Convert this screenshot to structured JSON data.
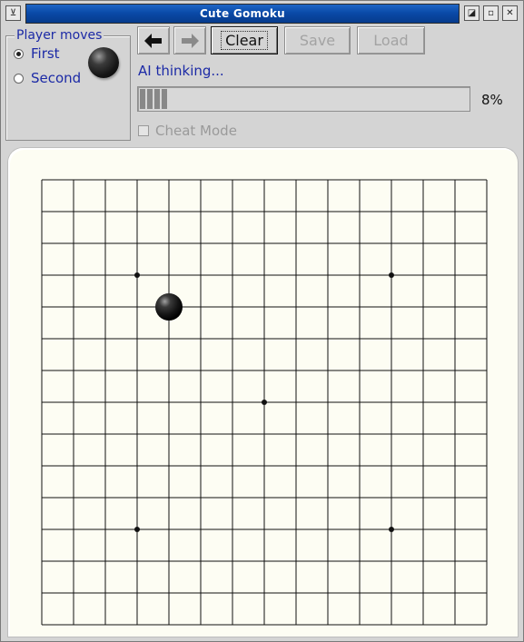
{
  "window": {
    "title": "Cute Gomoku",
    "menu_icon": "window-menu-icon",
    "buttons": [
      "maximize-icon",
      "minimize-icon",
      "close-icon"
    ]
  },
  "player_moves": {
    "title": "Player moves",
    "options": [
      {
        "label": "First",
        "selected": true
      },
      {
        "label": "Second",
        "selected": false
      }
    ],
    "stone_color": "black"
  },
  "toolbar": {
    "back_icon": "arrow-left-icon",
    "forward_icon": "arrow-right-icon",
    "clear_label": "Clear",
    "save_label": "Save",
    "load_label": "Load"
  },
  "status": {
    "thinking_text": "AI thinking...",
    "progress_percent": 8,
    "progress_label": "8%"
  },
  "cheat_mode": {
    "label": "Cheat Mode",
    "checked": false,
    "enabled": false
  },
  "board": {
    "size": 15,
    "star_points": [
      [
        3,
        3
      ],
      [
        11,
        3
      ],
      [
        7,
        7
      ],
      [
        3,
        11
      ],
      [
        11,
        11
      ]
    ],
    "stones": [
      {
        "col": 4,
        "row": 4,
        "color": "black"
      }
    ]
  },
  "colors": {
    "label_blue": "#1c2aa6",
    "title_blue": "#0a4aa8",
    "board_bg": "#fdfdf3"
  }
}
